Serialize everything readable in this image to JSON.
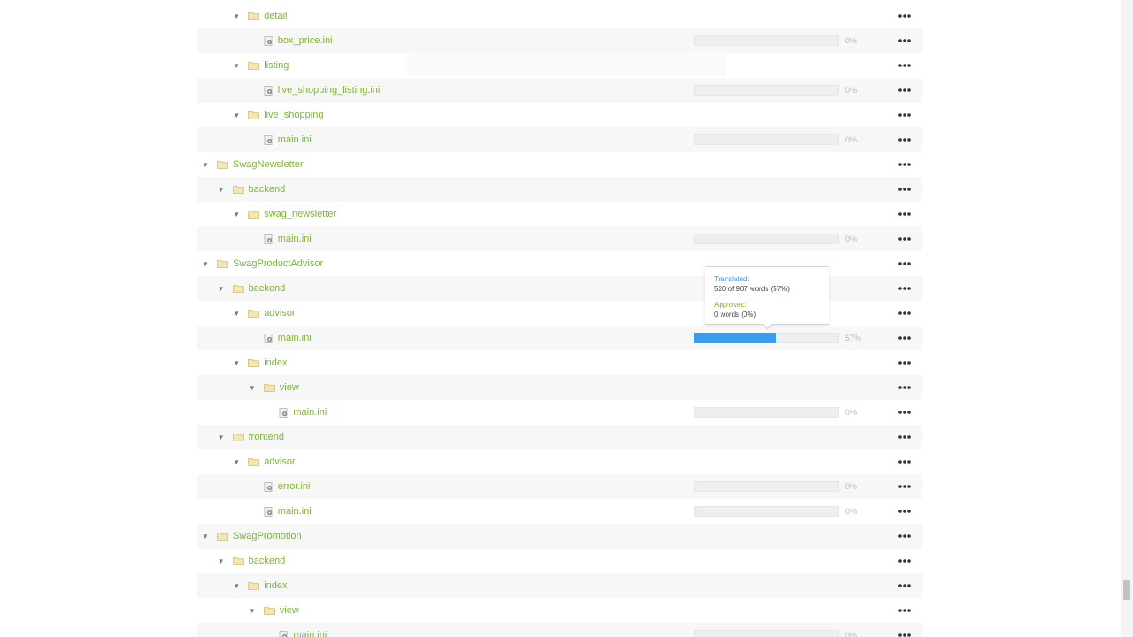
{
  "colors": {
    "link_green": "#7fb337",
    "progress_blue": "#3c9bec",
    "progress_track": "#eeeeee",
    "folder_fill": "#f2e6b5",
    "folder_stroke": "#d9c98a"
  },
  "tree": [
    {
      "type": "folder",
      "level": 2,
      "label": "detail"
    },
    {
      "type": "file",
      "level": 3,
      "label": "box_price.ini",
      "progress": 0,
      "pct": "0%"
    },
    {
      "type": "folder",
      "level": 2,
      "label": "listing"
    },
    {
      "type": "file",
      "level": 3,
      "label": "live_shopping_listing.ini",
      "progress": 0,
      "pct": "0%"
    },
    {
      "type": "folder",
      "level": 2,
      "label": "live_shopping"
    },
    {
      "type": "file",
      "level": 3,
      "label": "main.ini",
      "progress": 0,
      "pct": "0%"
    },
    {
      "type": "folder",
      "level": 0,
      "label": "SwagNewsletter"
    },
    {
      "type": "folder",
      "level": 1,
      "label": "backend"
    },
    {
      "type": "folder",
      "level": 2,
      "label": "swag_newsletter"
    },
    {
      "type": "file",
      "level": 3,
      "label": "main.ini",
      "progress": 0,
      "pct": "0%"
    },
    {
      "type": "folder",
      "level": 0,
      "label": "SwagProductAdvisor"
    },
    {
      "type": "folder",
      "level": 1,
      "label": "backend"
    },
    {
      "type": "folder",
      "level": 2,
      "label": "advisor"
    },
    {
      "type": "file",
      "level": 3,
      "label": "main.ini",
      "progress": 57,
      "pct": "57%"
    },
    {
      "type": "folder",
      "level": 2,
      "label": "index"
    },
    {
      "type": "folder",
      "level": 3,
      "label": "view"
    },
    {
      "type": "file",
      "level": 4,
      "label": "main.ini",
      "progress": 0,
      "pct": "0%"
    },
    {
      "type": "folder",
      "level": 1,
      "label": "frontend"
    },
    {
      "type": "folder",
      "level": 2,
      "label": "advisor"
    },
    {
      "type": "file",
      "level": 3,
      "label": "error.ini",
      "progress": 0,
      "pct": "0%"
    },
    {
      "type": "file",
      "level": 3,
      "label": "main.ini",
      "progress": 0,
      "pct": "0%"
    },
    {
      "type": "folder",
      "level": 0,
      "label": "SwagPromotion"
    },
    {
      "type": "folder",
      "level": 1,
      "label": "backend"
    },
    {
      "type": "folder",
      "level": 2,
      "label": "index"
    },
    {
      "type": "folder",
      "level": 3,
      "label": "view"
    },
    {
      "type": "file",
      "level": 4,
      "label": "main.ini",
      "progress": 0,
      "pct": "0%"
    }
  ],
  "tooltip": {
    "translated_label": "Translated:",
    "translated_value": "520 of 907 words (57%)",
    "approved_label": "Approved:",
    "approved_value": "0 words (0%)"
  },
  "icons": {
    "caret": "caret-down-icon",
    "folder": "folder-icon",
    "file": "file-gear-icon",
    "menu": "more-dots-icon"
  }
}
